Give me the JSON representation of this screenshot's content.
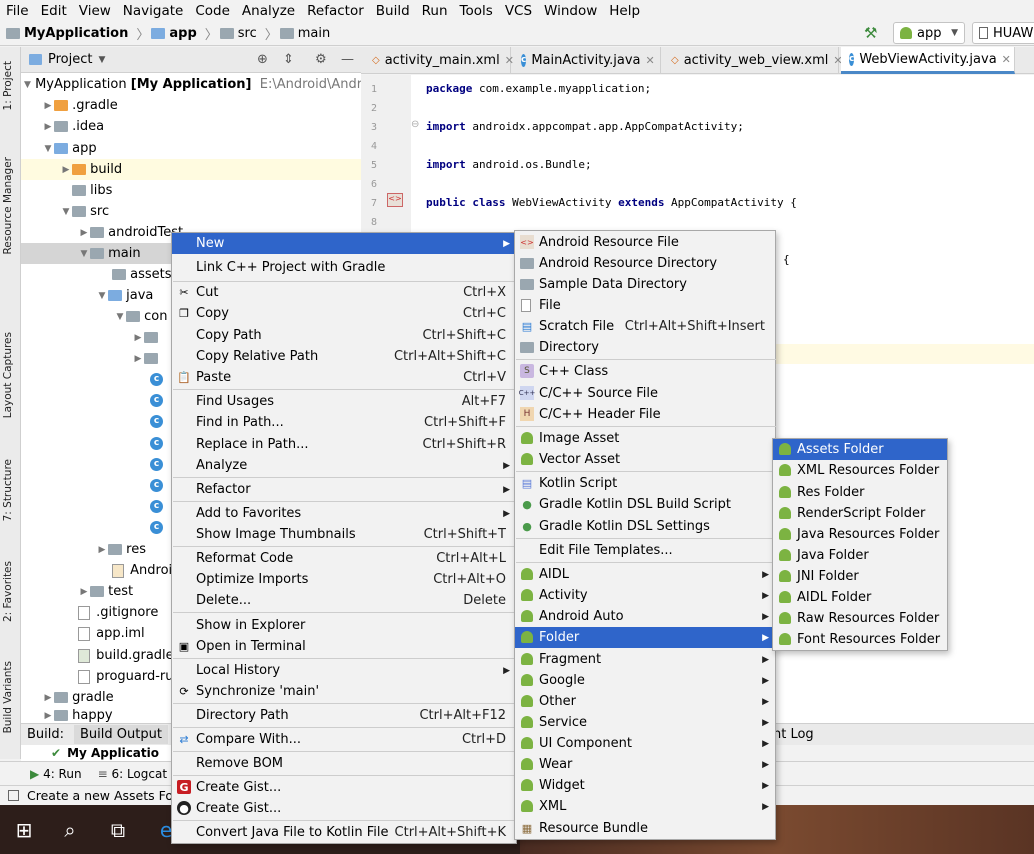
{
  "menubar": [
    "File",
    "Edit",
    "View",
    "Navigate",
    "Code",
    "Analyze",
    "Refactor",
    "Build",
    "Run",
    "Tools",
    "VCS",
    "Window",
    "Help"
  ],
  "breadcrumb": {
    "project": "MyApplication",
    "module": "app",
    "src": "src",
    "main": "main"
  },
  "run_config": {
    "app": "app",
    "device": "HUAW"
  },
  "left_strip": [
    "1: Project",
    "Resource Manager",
    "Layout Captures",
    "7: Structure",
    "2: Favorites",
    "Build Variants"
  ],
  "project_header": {
    "title": "Project"
  },
  "tree": [
    {
      "label": "MyApplication",
      "bold": "[My Application]",
      "path": "E:\\Android\\Andro"
    },
    {
      "label": ".gradle"
    },
    {
      "label": ".idea"
    },
    {
      "label": "app"
    },
    {
      "label": "build"
    },
    {
      "label": "libs"
    },
    {
      "label": "src"
    },
    {
      "label": "androidTest"
    },
    {
      "label": "main"
    },
    {
      "label": "assets"
    },
    {
      "label": "java"
    },
    {
      "label": "con"
    },
    {
      "label": "res"
    },
    {
      "label": "Androi"
    },
    {
      "label": "test"
    },
    {
      "label": ".gitignore"
    },
    {
      "label": "app.iml"
    },
    {
      "label": "build.gradle"
    },
    {
      "label": "proguard-rul"
    },
    {
      "label": "gradle"
    },
    {
      "label": "happy"
    }
  ],
  "editor_tabs": [
    "activity_main.xml",
    "MainActivity.java",
    "activity_web_view.xml",
    "WebViewActivity.java"
  ],
  "line_numbers": [
    "1",
    "2",
    "3",
    "4",
    "5",
    "6",
    "7",
    "8"
  ],
  "code": {
    "l1_kw": "package",
    "l1": " com.example.myapplication;",
    "l3_kw": "import",
    "l3": " androidx.appcompat.app.AppCompatActivity;",
    "l5_kw": "import",
    "l5": " android.os.Bundle;",
    "l7_kw1": "public class",
    "l7_a": " WebViewActivity ",
    "l7_kw2": "extends",
    "l7_b": " AppCompatActivity {",
    "brace": "{"
  },
  "build": {
    "label": "Build:",
    "tab": "Build Output",
    "row": "My Applicatio",
    "log": "nt Log"
  },
  "bottom_tabs": [
    "4: Run",
    "6: Logcat"
  ],
  "status": "Create a new Assets Folder",
  "context_menu": [
    {
      "label": "New",
      "shortcut": "",
      "submenu": true,
      "active": true
    },
    {
      "label": "Link C++ Project with Gradle",
      "shortcut": ""
    },
    {
      "label": "Cut",
      "shortcut": "Ctrl+X"
    },
    {
      "label": "Copy",
      "shortcut": "Ctrl+C"
    },
    {
      "label": "Copy Path",
      "shortcut": "Ctrl+Shift+C"
    },
    {
      "label": "Copy Relative Path",
      "shortcut": "Ctrl+Alt+Shift+C"
    },
    {
      "label": "Paste",
      "shortcut": "Ctrl+V"
    },
    {
      "label": "Find Usages",
      "shortcut": "Alt+F7"
    },
    {
      "label": "Find in Path...",
      "shortcut": "Ctrl+Shift+F"
    },
    {
      "label": "Replace in Path...",
      "shortcut": "Ctrl+Shift+R"
    },
    {
      "label": "Analyze",
      "shortcut": "",
      "submenu": true
    },
    {
      "label": "Refactor",
      "shortcut": "",
      "submenu": true
    },
    {
      "label": "Add to Favorites",
      "shortcut": "",
      "submenu": true
    },
    {
      "label": "Show Image Thumbnails",
      "shortcut": "Ctrl+Shift+T"
    },
    {
      "label": "Reformat Code",
      "shortcut": "Ctrl+Alt+L"
    },
    {
      "label": "Optimize Imports",
      "shortcut": "Ctrl+Alt+O"
    },
    {
      "label": "Delete...",
      "shortcut": "Delete"
    },
    {
      "label": "Show in Explorer",
      "shortcut": ""
    },
    {
      "label": "Open in Terminal",
      "shortcut": ""
    },
    {
      "label": "Local History",
      "shortcut": "",
      "submenu": true
    },
    {
      "label": "Synchronize 'main'",
      "shortcut": ""
    },
    {
      "label": "Directory Path",
      "shortcut": "Ctrl+Alt+F12"
    },
    {
      "label": "Compare With...",
      "shortcut": "Ctrl+D"
    },
    {
      "label": "Remove BOM",
      "shortcut": ""
    },
    {
      "label": "Create Gist...",
      "shortcut": ""
    },
    {
      "label": "Create Gist...",
      "shortcut": ""
    },
    {
      "label": "Convert Java File to Kotlin File",
      "shortcut": "Ctrl+Alt+Shift+K"
    }
  ],
  "new_menu": [
    {
      "label": "Android Resource File",
      "shortcut": ""
    },
    {
      "label": "Android Resource Directory",
      "shortcut": ""
    },
    {
      "label": "Sample Data Directory",
      "shortcut": ""
    },
    {
      "label": "File",
      "shortcut": ""
    },
    {
      "label": "Scratch File",
      "shortcut": "Ctrl+Alt+Shift+Insert"
    },
    {
      "label": "Directory",
      "shortcut": ""
    },
    {
      "label": "C++ Class",
      "shortcut": ""
    },
    {
      "label": "C/C++ Source File",
      "shortcut": ""
    },
    {
      "label": "C/C++ Header File",
      "shortcut": ""
    },
    {
      "label": "Image Asset",
      "shortcut": ""
    },
    {
      "label": "Vector Asset",
      "shortcut": ""
    },
    {
      "label": "Kotlin Script",
      "shortcut": ""
    },
    {
      "label": "Gradle Kotlin DSL Build Script",
      "shortcut": ""
    },
    {
      "label": "Gradle Kotlin DSL Settings",
      "shortcut": ""
    },
    {
      "label": "Edit File Templates...",
      "shortcut": ""
    },
    {
      "label": "AIDL",
      "shortcut": ""
    },
    {
      "label": "Activity",
      "shortcut": ""
    },
    {
      "label": "Android Auto",
      "shortcut": ""
    },
    {
      "label": "Folder",
      "shortcut": ""
    },
    {
      "label": "Fragment",
      "shortcut": ""
    },
    {
      "label": "Google",
      "shortcut": ""
    },
    {
      "label": "Other",
      "shortcut": ""
    },
    {
      "label": "Service",
      "shortcut": ""
    },
    {
      "label": "UI Component",
      "shortcut": ""
    },
    {
      "label": "Wear",
      "shortcut": ""
    },
    {
      "label": "Widget",
      "shortcut": ""
    },
    {
      "label": "XML",
      "shortcut": ""
    },
    {
      "label": "Resource Bundle",
      "shortcut": ""
    }
  ],
  "folder_menu": [
    "Assets Folder",
    "XML Resources Folder",
    "Res Folder",
    "RenderScript Folder",
    "Java Resources Folder",
    "Java Folder",
    "JNI Folder",
    "AIDL Folder",
    "Raw Resources Folder",
    "Font Resources Folder"
  ],
  "colors": {
    "selection": "#2f65ca",
    "android_green": "#7cb342",
    "keyword": "#000080"
  }
}
